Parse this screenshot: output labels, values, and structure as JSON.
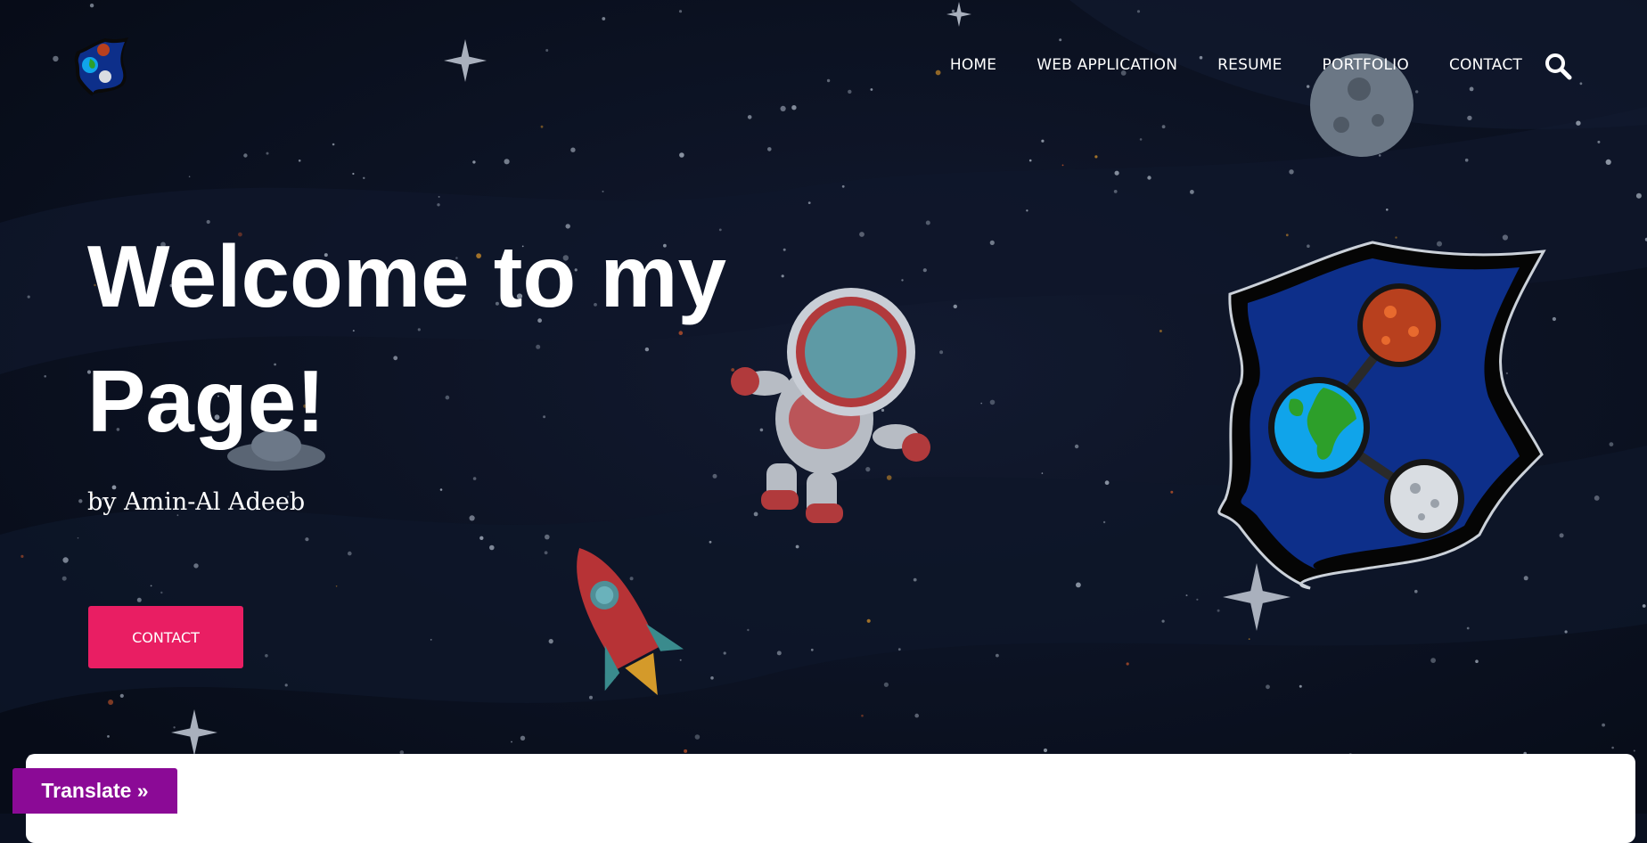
{
  "nav": {
    "items": [
      "HOME",
      "WEB APPLICATION",
      "RESUME",
      "PORTFOLIO",
      "CONTACT"
    ]
  },
  "icons": {
    "logo": "planet-badge-icon",
    "search": "search-icon"
  },
  "hero": {
    "title": "Welcome to my Page!",
    "subtitle": "by Amin-Al Adeeb",
    "button_label": "CONTACT"
  },
  "translate": {
    "label": "Translate »"
  },
  "colors": {
    "background": "#0a1020",
    "accent": "#e91e63",
    "translate_bg": "#8b0a96",
    "badge_blue": "#0d2f8a",
    "earth": "#10a4ea",
    "mars": "#b8401e"
  }
}
